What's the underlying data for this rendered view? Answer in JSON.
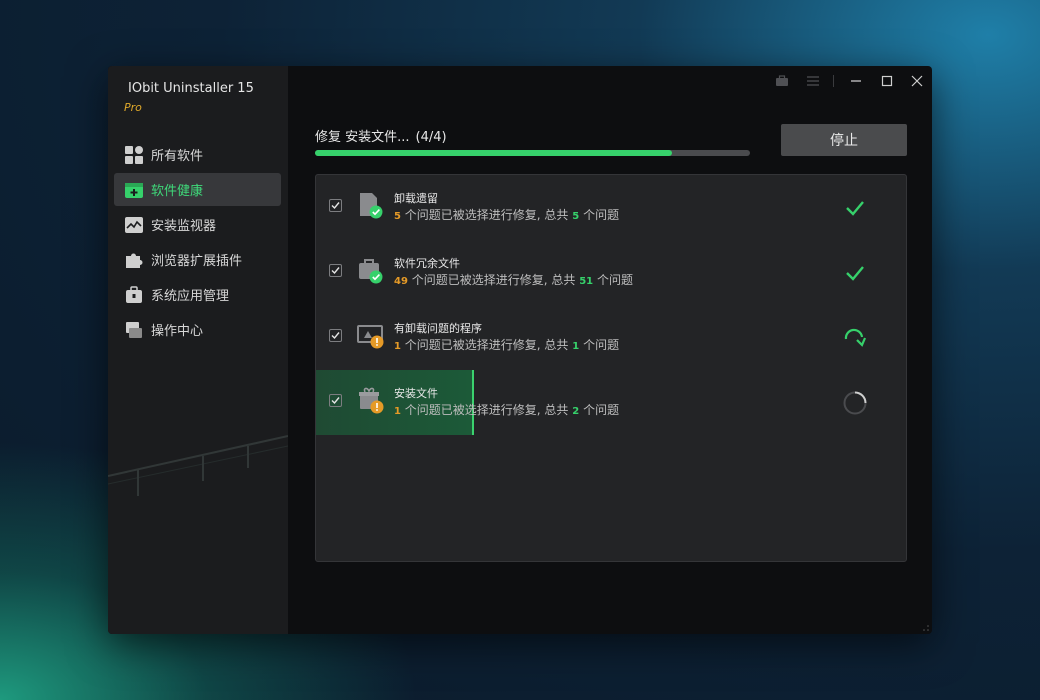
{
  "app": {
    "title": "IObit Uninstaller 15",
    "edition": "Pro"
  },
  "sidebar": {
    "items": [
      {
        "label": "所有软件",
        "icon": "all-software-icon",
        "active": false
      },
      {
        "label": "软件健康",
        "icon": "software-health-icon",
        "active": true
      },
      {
        "label": "安装监视器",
        "icon": "install-monitor-icon",
        "active": false
      },
      {
        "label": "浏览器扩展插件",
        "icon": "browser-extension-icon",
        "active": false
      },
      {
        "label": "系统应用管理",
        "icon": "system-app-icon",
        "active": false
      },
      {
        "label": "操作中心",
        "icon": "action-center-icon",
        "active": false
      }
    ]
  },
  "status": {
    "text": "修复 安装文件...",
    "count": "(4/4)",
    "progress_percent": 82
  },
  "stop_button": {
    "label": "停止"
  },
  "rows": [
    {
      "title": "卸载遗留",
      "selected": "5",
      "desc_mid": "个问题已被选择进行修复,  总共",
      "total": "5",
      "desc_end": "个问题",
      "state": "done",
      "icon": "leftover-file-icon"
    },
    {
      "title": "软件冗余文件",
      "selected": "49",
      "desc_mid": "个问题已被选择进行修复,  总共",
      "total": "51",
      "desc_end": "个问题",
      "state": "done",
      "icon": "redundant-file-icon"
    },
    {
      "title": "有卸载问题的程序",
      "selected": "1",
      "desc_mid": "个问题已被选择进行修复,  总共",
      "total": "1",
      "desc_end": "个问题",
      "state": "skipped",
      "icon": "problem-program-icon"
    },
    {
      "title": "安装文件",
      "selected": "1",
      "desc_mid": "个问题已被选择进行修复,  总共",
      "total": "2",
      "desc_end": "个问题",
      "state": "in-progress",
      "icon": "install-file-icon"
    }
  ],
  "colors": {
    "accent": "#36d16b",
    "warning": "#e59a27",
    "edition": "#e0a92a"
  }
}
